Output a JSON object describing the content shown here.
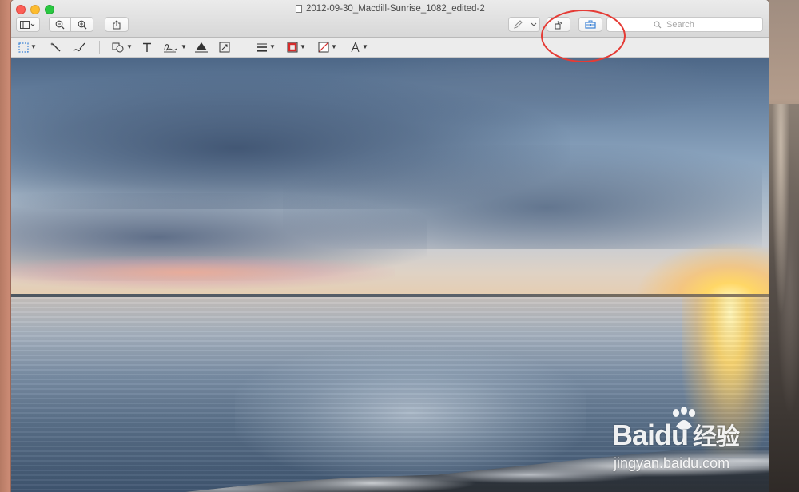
{
  "window": {
    "title": "2012-09-30_Macdill-Sunrise_1082_edited-2"
  },
  "toolbar": {
    "search_placeholder": "Search"
  },
  "icons": {
    "traffic_close": "close-icon",
    "traffic_minimize": "minimize-icon",
    "traffic_zoom": "zoom-icon",
    "sidebar": "sidebar-icon",
    "zoom_out": "zoom-out-icon",
    "zoom_in": "zoom-in-icon",
    "share": "share-icon",
    "markup": "pen-icon",
    "rotate": "rotate-icon",
    "toolbox": "toolbox-icon",
    "search": "search-icon",
    "select": "rect-select-icon",
    "instant_alpha": "magic-wand-icon",
    "sketch": "sketch-icon",
    "shapes": "shapes-icon",
    "text": "text-icon",
    "sign": "signature-icon",
    "adjust_color": "adjust-color-icon",
    "adjust_size": "resize-icon",
    "shape_style": "line-style-icon",
    "border_color": "border-color-icon",
    "fill_color": "fill-color-icon",
    "text_style": "text-style-icon"
  },
  "colors": {
    "traffic_close": "#fc5f57",
    "traffic_minimize": "#fdbc2e",
    "traffic_zoom": "#29c840",
    "accent_blue": "#3b82d6",
    "border_color_swatch": "#d62b2b",
    "annotation": "#e53b35"
  },
  "watermark": {
    "brand_prefix": "Bai",
    "brand_suffix": "du",
    "brand_cn": "经验",
    "url": "jingyan.baidu.com"
  }
}
